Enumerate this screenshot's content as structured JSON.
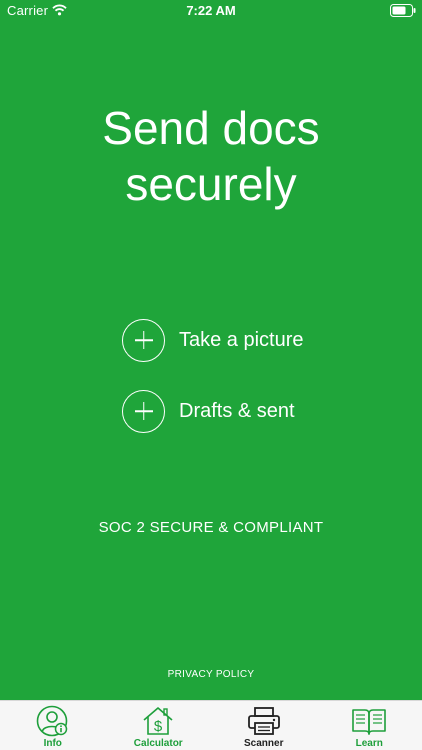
{
  "status_bar": {
    "carrier": "Carrier",
    "time": "7:22 AM"
  },
  "main": {
    "headline_line1": "Send docs",
    "headline_line2": "securely",
    "actions": [
      {
        "label": "Take a picture",
        "icon": "plus-circle-icon"
      },
      {
        "label": "Drafts & sent",
        "icon": "plus-circle-icon"
      }
    ],
    "compliance": "SOC 2 SECURE & COMPLIANT",
    "privacy_link": "PRIVACY POLICY"
  },
  "tab_bar": {
    "items": [
      {
        "label": "Info",
        "icon": "user-info-icon"
      },
      {
        "label": "Calculator",
        "icon": "house-dollar-icon"
      },
      {
        "label": "Scanner",
        "icon": "printer-icon",
        "active": true
      },
      {
        "label": "Learn",
        "icon": "book-icon"
      }
    ]
  },
  "colors": {
    "background": "#1fa53a",
    "tab_accent": "#1e9f3b",
    "tab_active": "#222222",
    "tab_bar_bg": "#f6f6f6"
  }
}
